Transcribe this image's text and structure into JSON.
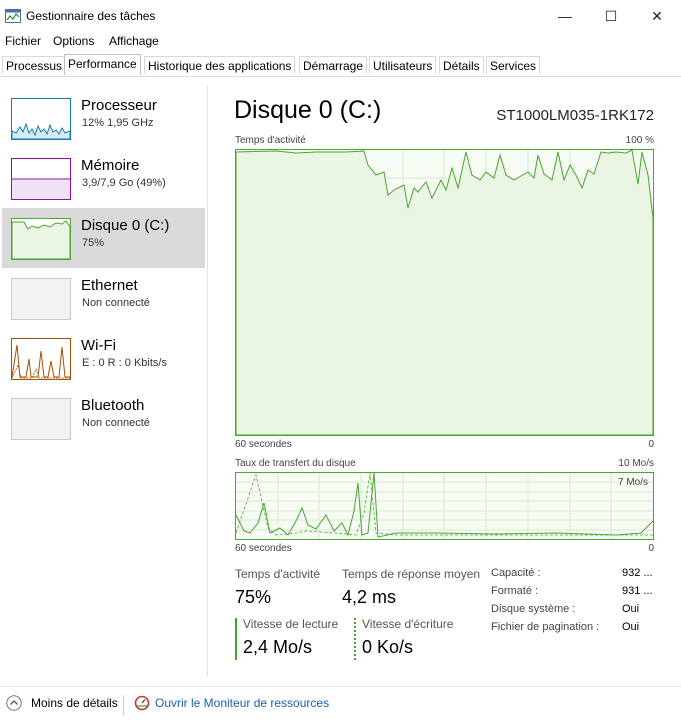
{
  "window": {
    "title": "Gestionnaire des tâches",
    "minimize": "—",
    "maximize": "☐",
    "close": "✕"
  },
  "menu": [
    "Fichier",
    "Options",
    "Affichage"
  ],
  "tabs": [
    "Processus",
    "Performance",
    "Historique des applications",
    "Démarrage",
    "Utilisateurs",
    "Détails",
    "Services"
  ],
  "sidebar": {
    "items": [
      {
        "name": "Processeur",
        "sub": "12% 1,95 GHz"
      },
      {
        "name": "Mémoire",
        "sub": "3,9/7,9 Go (49%)"
      },
      {
        "name": "Disque 0 (C:)",
        "sub": "75%"
      },
      {
        "name": "Ethernet",
        "sub": "Non connecté"
      },
      {
        "name": "Wi-Fi",
        "sub": "E : 0 R : 0 Kbits/s"
      },
      {
        "name": "Bluetooth",
        "sub": "Non connecté"
      }
    ]
  },
  "main": {
    "title": "Disque 0 (C:)",
    "model": "ST1000LM035-1RK172",
    "activity_graph": {
      "label": "Temps d'activité",
      "max": "100 %",
      "time": "60 secondes",
      "min": "0"
    },
    "transfer_graph": {
      "label": "Taux de transfert du disque",
      "max": "10 Mo/s",
      "inner": "7 Mo/s",
      "time": "60 secondes",
      "min": "0"
    },
    "stats": {
      "activity_label": "Temps d'activité",
      "activity_value": "75%",
      "response_label": "Temps de réponse moyen",
      "response_value": "4,2 ms",
      "read_label": "Vitesse de lecture",
      "read_value": "2,4 Mo/s",
      "write_label": "Vitesse d'écriture",
      "write_value": "0 Ko/s"
    },
    "info": [
      {
        "label": "Capacité :",
        "value": "932 ..."
      },
      {
        "label": "Formaté :",
        "value": "931 ..."
      },
      {
        "label": "Disque système :",
        "value": "Oui"
      },
      {
        "label": "Fichier de pagination :",
        "value": "Oui"
      }
    ]
  },
  "footer": {
    "less_details": "Moins de détails",
    "resource_monitor": "Ouvrir le Moniteur de ressources"
  },
  "colors": {
    "disk": "#4aa532",
    "cpu": "#117dbb",
    "memory": "#8b12ae",
    "wifi": "#a74f01"
  }
}
